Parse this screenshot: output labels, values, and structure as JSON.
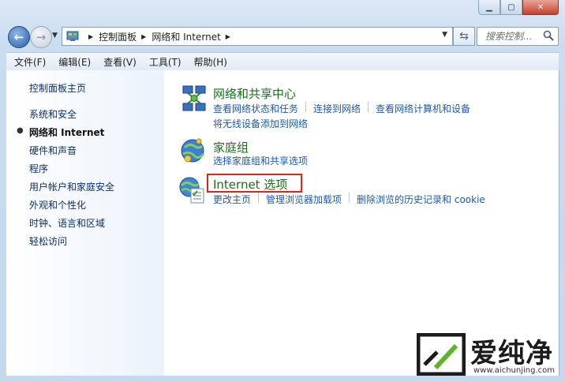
{
  "window": {
    "caption_buttons": {
      "minimize": "▁",
      "maximize": "▢",
      "close": "✕"
    }
  },
  "nav": {
    "breadcrumbs": [
      "控制面板",
      "网络和 Internet"
    ],
    "search_placeholder": "搜索控制..."
  },
  "menu": [
    "文件(F)",
    "编辑(E)",
    "查看(V)",
    "工具(T)",
    "帮助(H)"
  ],
  "sidebar": {
    "home": "控制面板主页",
    "items": [
      "系统和安全",
      "网络和 Internet",
      "硬件和声音",
      "程序",
      "用户帐户和家庭安全",
      "外观和个性化",
      "时钟、语言和区域",
      "轻松访问"
    ],
    "current_index": 1
  },
  "categories": [
    {
      "title": "网络和共享中心",
      "icon": "network-sharing-center-icon",
      "tasks_line1": [
        "查看网络状态和任务",
        "连接到网络",
        "查看网络计算机和设备"
      ],
      "tasks_line2": [
        "将无线设备添加到网络"
      ]
    },
    {
      "title": "家庭组",
      "icon": "homegroup-icon",
      "tasks_line1": [
        "选择家庭组和共享选项"
      ]
    },
    {
      "title": "Internet 选项",
      "icon": "internet-options-icon",
      "tasks_line1": [
        "更改主页",
        "管理浏览器加载项",
        "删除浏览的历史记录和 cookie"
      ]
    }
  ],
  "watermark": {
    "text": "爱纯净",
    "url": "www.aichunjing.com"
  },
  "colors": {
    "category_title": "#1c6c1c",
    "task_link": "#1e5ba8",
    "highlight_box": "#d9261c"
  }
}
